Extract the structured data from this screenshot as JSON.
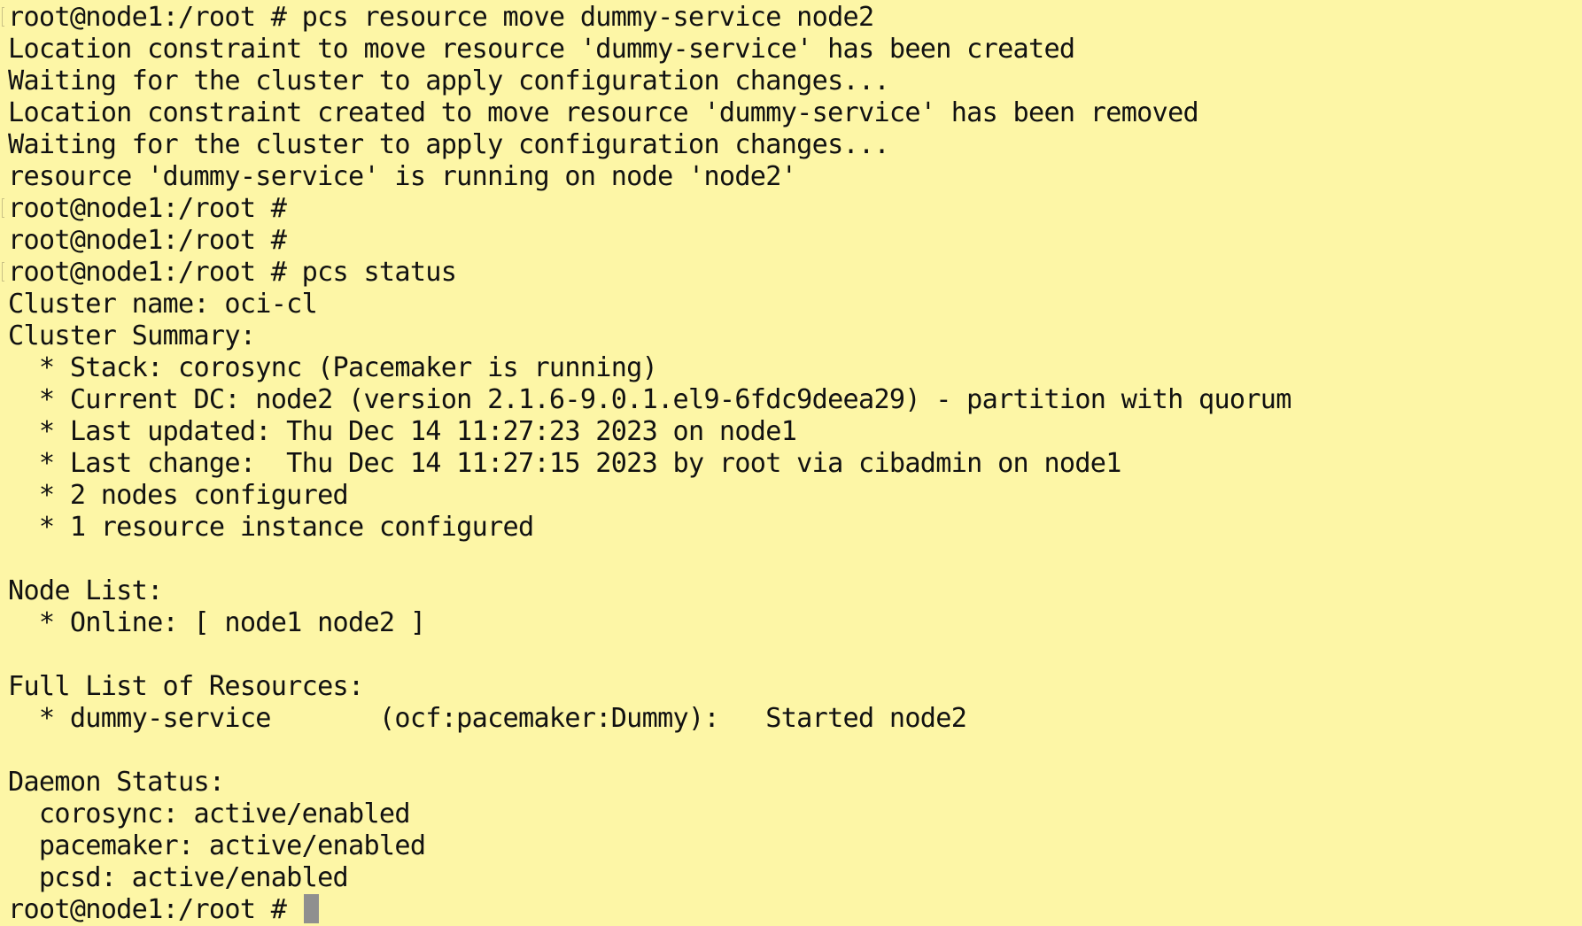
{
  "terminal": {
    "colors": {
      "background": "#fdf6a6",
      "foreground": "#111111",
      "cursor": "#8f8f8f"
    },
    "lines": [
      "root@node1:/root # pcs resource move dummy-service node2",
      "Location constraint to move resource 'dummy-service' has been created",
      "Waiting for the cluster to apply configuration changes...",
      "Location constraint created to move resource 'dummy-service' has been removed",
      "Waiting for the cluster to apply configuration changes...",
      "resource 'dummy-service' is running on node 'node2'",
      "root@node1:/root #",
      "root@node1:/root #",
      "root@node1:/root # pcs status",
      "Cluster name: oci-cl",
      "Cluster Summary:",
      "  * Stack: corosync (Pacemaker is running)",
      "  * Current DC: node2 (version 2.1.6-9.0.1.el9-6fdc9deea29) - partition with quorum",
      "  * Last updated: Thu Dec 14 11:27:23 2023 on node1",
      "  * Last change:  Thu Dec 14 11:27:15 2023 by root via cibadmin on node1",
      "  * 2 nodes configured",
      "  * 1 resource instance configured",
      "",
      "Node List:",
      "  * Online: [ node1 node2 ]",
      "",
      "Full List of Resources:",
      "  * dummy-service       (ocf:pacemaker:Dummy):   Started node2",
      "",
      "Daemon Status:",
      "  corosync: active/enabled",
      "  pacemaker: active/enabled",
      "  pcsd: active/enabled"
    ],
    "prompt": "root@node1:/root # "
  }
}
